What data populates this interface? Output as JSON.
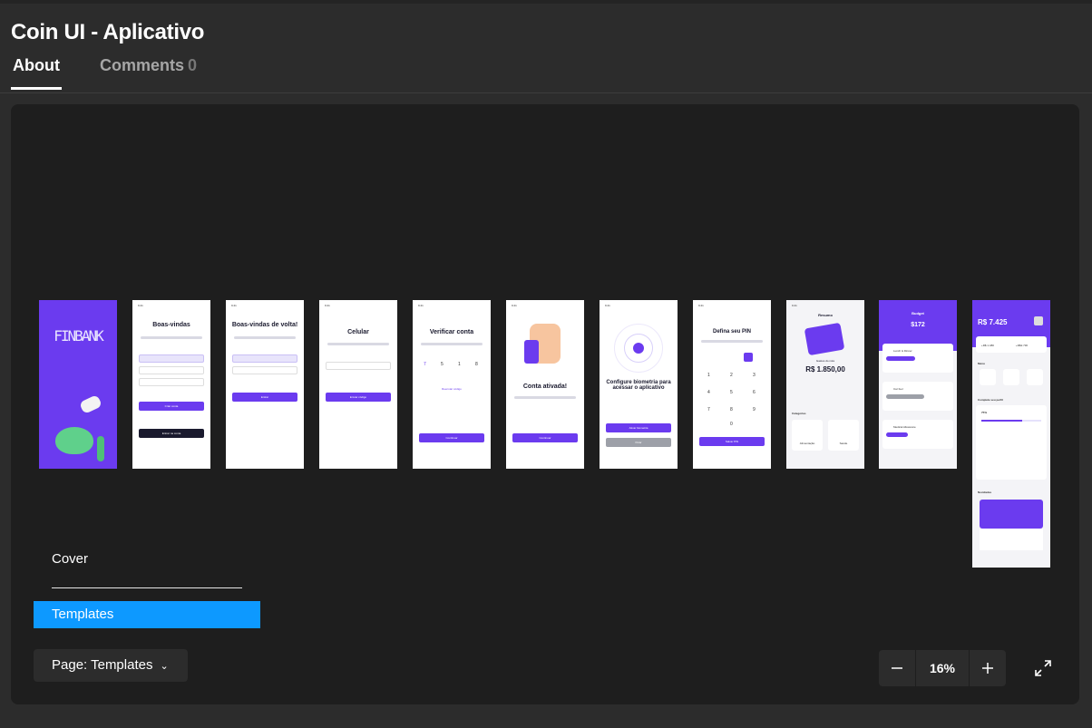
{
  "header": {
    "title": "Coin UI - Aplicativo",
    "tabs": [
      {
        "label": "About",
        "active": true
      },
      {
        "label": "Comments",
        "count": "0"
      }
    ]
  },
  "frames": {
    "cover_logo": "FINBANK",
    "screen1": {
      "title": "Boas-vindas",
      "btn1": "Criar conta",
      "btn2": "Entrar na conta"
    },
    "screen2": {
      "title": "Boas-vindas de volta!",
      "btn1": "Entrar"
    },
    "screen3": {
      "title": "Celular",
      "btn1": "Enviar código"
    },
    "screen4": {
      "title": "Verificar conta",
      "digits": [
        "7",
        "5",
        "1",
        "8"
      ],
      "link": "Reenviar código",
      "btn1": "Continuar"
    },
    "screen5": {
      "title": "Conta ativada!",
      "btn1": "Continuar"
    },
    "screen6": {
      "title": "Configure biometria para acessar o aplicativo",
      "btn1": "Ativar biometria",
      "btn2": "Pular"
    },
    "screen7": {
      "title": "Defina seu PIN",
      "keys": [
        "1",
        "2",
        "3",
        "4",
        "5",
        "6",
        "7",
        "8",
        "9",
        "0"
      ],
      "btn1": "Salvar PIN"
    },
    "screen8": {
      "title": "Resumo",
      "label": "Gastos do mês",
      "amount": "R$ 1.850,00",
      "section": "Categorias",
      "cat1": "Alimentação",
      "cat2": "Saúde"
    },
    "screen9": {
      "title": "Budget",
      "amount": "$172",
      "item1": "Lunch & Dinner",
      "item2": "Car fuel",
      "item3": "Medical Allowance"
    },
    "screen10": {
      "balance": "R$ 7.425",
      "in": "+R$ 1.480",
      "out": "+R$2.730",
      "section1": "Menu",
      "section2": "Complete seu perfil",
      "progress": "75%",
      "section3": "Novidades"
    }
  },
  "pages": {
    "cover": "Cover",
    "templates": "Templates",
    "selector": "Page: Templates"
  },
  "zoom": {
    "value": "16%"
  },
  "colors": {
    "accent": "#6b3bef",
    "selection": "#0d99ff"
  }
}
